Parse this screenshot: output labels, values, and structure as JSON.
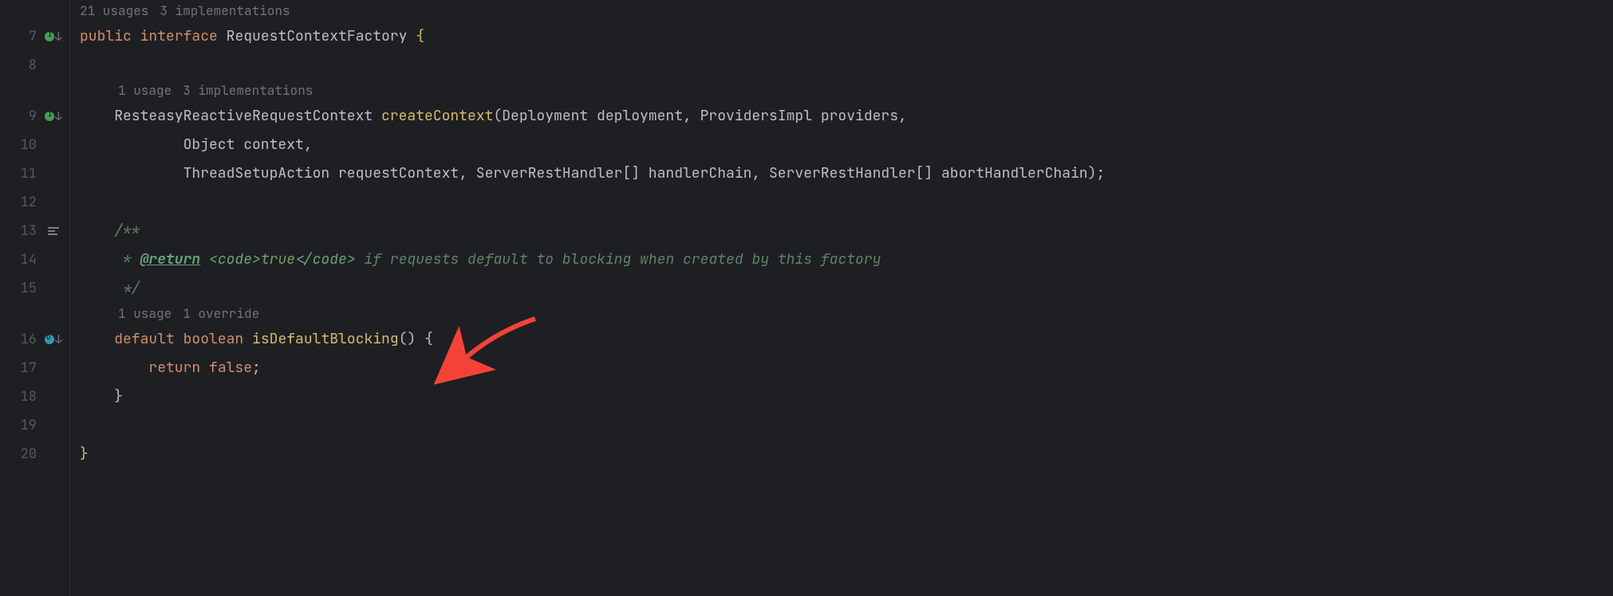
{
  "inlay": {
    "class": {
      "usages": "21 usages",
      "impls": "3 implementations"
    },
    "createContext": {
      "usages": "1 usage",
      "impls": "3 implementations"
    },
    "isDefaultBlocking": {
      "usages": "1 usage",
      "overrides": "1 override"
    }
  },
  "lines": {
    "l7": {
      "n": "7",
      "kw1": "public",
      "kw2": "interface",
      "name": "RequestContextFactory",
      "brace": "{"
    },
    "l8": {
      "n": "8"
    },
    "l9": {
      "n": "9",
      "ret": "ResteasyReactiveRequestContext",
      "mth": "createContext",
      "sig1": "(Deployment deployment, ProvidersImpl providers,"
    },
    "l10": {
      "n": "10",
      "cont": "Object context,"
    },
    "l11": {
      "n": "11",
      "cont": "ThreadSetupAction requestContext, ServerRestHandler[] handlerChain, ServerRestHandler[] abortHandlerChain);"
    },
    "l12": {
      "n": "12"
    },
    "l13": {
      "n": "13",
      "open": "/**"
    },
    "l14": {
      "n": "14",
      "star": " * ",
      "ret": "@return",
      "sp": " ",
      "t1": "<code>",
      "lit": "true",
      "t2": "</code>",
      "rest": " if requests default to blocking when created by this factory"
    },
    "l15": {
      "n": "15",
      "close": " */"
    },
    "l16": {
      "n": "16",
      "kw1": "default",
      "kw2": "boolean",
      "mth": "isDefaultBlocking",
      "sig": "()",
      "brace": "{"
    },
    "l17": {
      "n": "17",
      "kw": "return",
      "lit": "false",
      "semi": ";"
    },
    "l18": {
      "n": "18",
      "brace": "}"
    },
    "l19": {
      "n": "19"
    },
    "l20": {
      "n": "20",
      "brace": "}"
    }
  },
  "icons": {
    "interface": "interface-icon",
    "override": "override-icon",
    "inherit": "inherit-arrow-icon",
    "doc": "doc-comment-icon"
  },
  "annotation": {
    "arrow_color": "#f44336"
  }
}
